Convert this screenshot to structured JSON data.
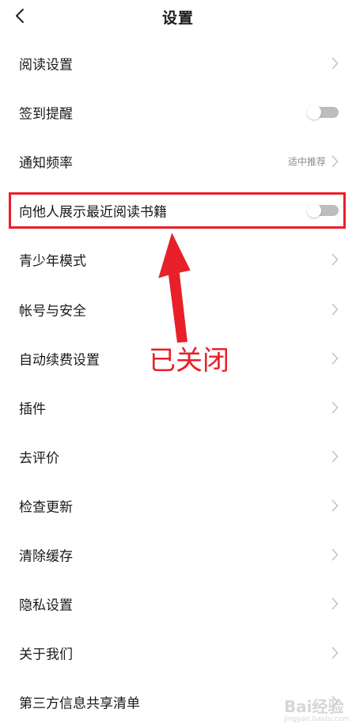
{
  "header": {
    "title": "设置"
  },
  "settings": [
    {
      "label": "阅读设置",
      "control": "chevron"
    },
    {
      "label": "签到提醒",
      "control": "toggle",
      "on": false
    },
    {
      "label": "通知频率",
      "control": "chevron",
      "value": "适中推荐"
    },
    {
      "label": "向他人展示最近阅读书籍",
      "control": "toggle",
      "on": false
    },
    {
      "label": "青少年模式",
      "control": "chevron"
    },
    {
      "label": "帐号与安全",
      "control": "chevron"
    },
    {
      "label": "自动续费设置",
      "control": "chevron"
    },
    {
      "label": "插件",
      "control": "chevron"
    },
    {
      "label": "去评价",
      "control": "chevron"
    },
    {
      "label": "检查更新",
      "control": "chevron"
    },
    {
      "label": "清除缓存",
      "control": "chevron"
    },
    {
      "label": "隐私设置",
      "control": "chevron"
    },
    {
      "label": "关于我们",
      "control": "chevron"
    },
    {
      "label": "第三方信息共享清单",
      "control": "chevron"
    }
  ],
  "annotation": {
    "text": "已关闭"
  },
  "watermark": {
    "text": "Bai经验",
    "sub": "jingyan.baidu.com"
  },
  "colors": {
    "annotation": "#e8202a",
    "toggle_off_track": "#bdbdbd",
    "chevron": "#c4c4c4",
    "secondary_text": "#8a8a8a"
  },
  "icons": {
    "back": "chevron-left-icon",
    "row_chevron": "chevron-right-icon"
  }
}
